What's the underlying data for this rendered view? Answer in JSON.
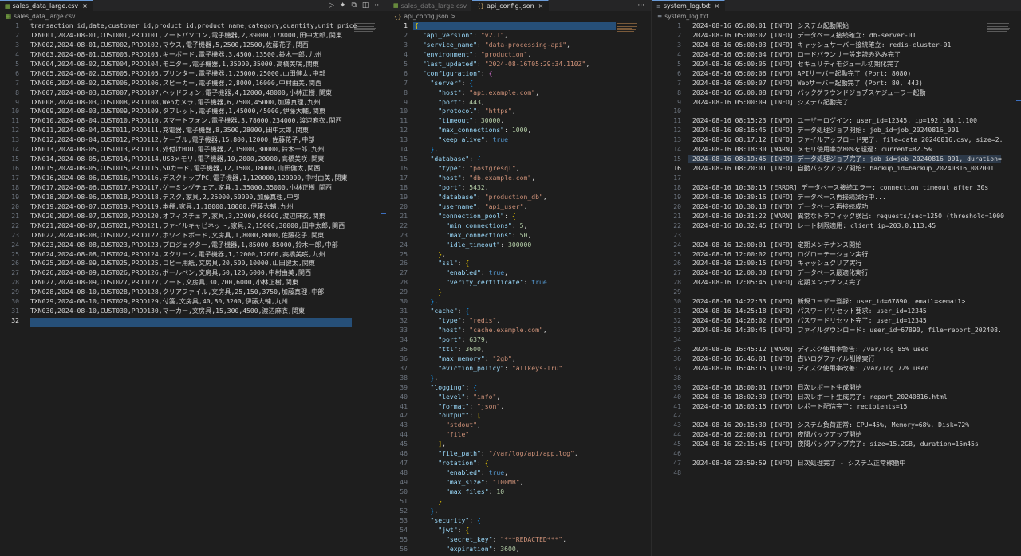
{
  "csv_pane": {
    "tab": {
      "label": "sales_data_large.csv",
      "close": "×"
    },
    "breadcrumb": "sales_data_large.csv",
    "current_line": "32",
    "lines": [
      "transaction_id,date,customer_id,product_id,product_name,category,quantity,unit_price",
      "TXN001,2024-08-01,CUST001,PROD101,ノートパソコン,電子機器,2,89000,178000,田中太郎,関東",
      "TXN002,2024-08-01,CUST002,PROD102,マウス,電子機器,5,2500,12500,佐藤花子,関西",
      "TXN003,2024-08-01,CUST003,PROD103,キーボード,電子機器,3,4500,13500,鈴木一郎,九州",
      "TXN004,2024-08-02,CUST004,PROD104,モニター,電子機器,1,35000,35000,高橋美咲,関東",
      "TXN005,2024-08-02,CUST005,PROD105,プリンター,電子機器,1,25000,25000,山田健太,中部",
      "TXN006,2024-08-02,CUST006,PROD106,スピーカー,電子機器,2,8000,16000,中村由美,関西",
      "TXN007,2024-08-03,CUST007,PROD107,ヘッドフォン,電子機器,4,12000,48000,小林正樹,関東",
      "TXN008,2024-08-03,CUST008,PROD108,Webカメラ,電子機器,6,7500,45000,加藤真理,九州",
      "TXN009,2024-08-03,CUST009,PROD109,タブレット,電子機器,1,45000,45000,伊藤大輔,関東",
      "TXN010,2024-08-04,CUST010,PROD110,スマートフォン,電子機器,3,78000,234000,渡辺麻衣,関西",
      "TXN011,2024-08-04,CUST011,PROD111,充電器,電子機器,8,3500,28000,田中太郎,関東",
      "TXN012,2024-08-04,CUST012,PROD112,ケーブル,電子機器,15,800,12000,佐藤花子,中部",
      "TXN013,2024-08-05,CUST013,PROD113,外付けHDD,電子機器,2,15000,30000,鈴木一郎,九州",
      "TXN014,2024-08-05,CUST014,PROD114,USBメモリ,電子機器,10,2000,20000,高橋美咲,関東",
      "TXN015,2024-08-05,CUST015,PROD115,SDカード,電子機器,12,1500,18000,山田健太,関西",
      "TXN016,2024-08-06,CUST016,PROD116,デスクトップPC,電子機器,1,120000,120000,中村由美,関東",
      "TXN017,2024-08-06,CUST017,PROD117,ゲーミングチェア,家具,1,35000,35000,小林正樹,関西",
      "TXN018,2024-08-06,CUST018,PROD118,デスク,家具,2,25000,50000,加藤真理,中部",
      "TXN019,2024-08-07,CUST019,PROD119,本棚,家具,1,18000,18000,伊藤大輔,九州",
      "TXN020,2024-08-07,CUST020,PROD120,オフィスチェア,家具,3,22000,66000,渡辺麻衣,関東",
      "TXN021,2024-08-07,CUST021,PROD121,ファイルキャビネット,家具,2,15000,30000,田中太郎,関西",
      "TXN022,2024-08-08,CUST022,PROD122,ホワイトボード,文房具,1,8000,8000,佐藤花子,関東",
      "TXN023,2024-08-08,CUST023,PROD123,プロジェクター,電子機器,1,85000,85000,鈴木一郎,中部",
      "TXN024,2024-08-08,CUST024,PROD124,スクリーン,電子機器,1,12000,12000,高橋美咲,九州",
      "TXN025,2024-08-09,CUST025,PROD125,コピー用紙,文房具,20,500,10000,山田健太,関東",
      "TXN026,2024-08-09,CUST026,PROD126,ボールペン,文房具,50,120,6000,中村由美,関西",
      "TXN027,2024-08-09,CUST027,PROD127,ノート,文房具,30,200,6000,小林正樹,関東",
      "TXN028,2024-08-10,CUST028,PROD128,クリアファイル,文房具,25,150,3750,加藤真理,中部",
      "TXN029,2024-08-10,CUST029,PROD129,付箋,文房具,40,80,3200,伊藤大輔,九州",
      "TXN030,2024-08-10,CUST030,PROD130,マーカー,文房具,15,300,4500,渡辺麻衣,関東",
      ""
    ]
  },
  "json_pane": {
    "tab_inactive": {
      "label": "sales_data_large.csv"
    },
    "tab": {
      "label": "api_config.json",
      "close": "×"
    },
    "breadcrumb": {
      "file": "api_config.json",
      "sep": ">",
      "rest": "..."
    },
    "more": "···",
    "current_line": "1",
    "lines": [
      [
        [
          "br1",
          "{"
        ]
      ],
      [
        [
          "p",
          "  "
        ],
        [
          "k",
          "\"api_version\""
        ],
        [
          "p",
          ": "
        ],
        [
          "s",
          "\"v2.1\""
        ],
        [
          "p",
          ","
        ]
      ],
      [
        [
          "p",
          "  "
        ],
        [
          "k",
          "\"service_name\""
        ],
        [
          "p",
          ": "
        ],
        [
          "s",
          "\"data-processing-api\""
        ],
        [
          "p",
          ","
        ]
      ],
      [
        [
          "p",
          "  "
        ],
        [
          "k",
          "\"environment\""
        ],
        [
          "p",
          ": "
        ],
        [
          "s",
          "\"production\""
        ],
        [
          "p",
          ","
        ]
      ],
      [
        [
          "p",
          "  "
        ],
        [
          "k",
          "\"last_updated\""
        ],
        [
          "p",
          ": "
        ],
        [
          "s",
          "\"2024-08-16T05:29:34.110Z\""
        ],
        [
          "p",
          ","
        ]
      ],
      [
        [
          "p",
          "  "
        ],
        [
          "k",
          "\"configuration\""
        ],
        [
          "p",
          ": "
        ],
        [
          "br2",
          "{"
        ]
      ],
      [
        [
          "p",
          "    "
        ],
        [
          "k",
          "\"server\""
        ],
        [
          "p",
          ": "
        ],
        [
          "br3",
          "{"
        ]
      ],
      [
        [
          "p",
          "      "
        ],
        [
          "k",
          "\"host\""
        ],
        [
          "p",
          ": "
        ],
        [
          "s",
          "\"api.example.com\""
        ],
        [
          "p",
          ","
        ]
      ],
      [
        [
          "p",
          "      "
        ],
        [
          "k",
          "\"port\""
        ],
        [
          "p",
          ": "
        ],
        [
          "n",
          "443"
        ],
        [
          "p",
          ","
        ]
      ],
      [
        [
          "p",
          "      "
        ],
        [
          "k",
          "\"protocol\""
        ],
        [
          "p",
          ": "
        ],
        [
          "s",
          "\"https\""
        ],
        [
          "p",
          ","
        ]
      ],
      [
        [
          "p",
          "      "
        ],
        [
          "k",
          "\"timeout\""
        ],
        [
          "p",
          ": "
        ],
        [
          "n",
          "30000"
        ],
        [
          "p",
          ","
        ]
      ],
      [
        [
          "p",
          "      "
        ],
        [
          "k",
          "\"max_connections\""
        ],
        [
          "p",
          ": "
        ],
        [
          "n",
          "1000"
        ],
        [
          "p",
          ","
        ]
      ],
      [
        [
          "p",
          "      "
        ],
        [
          "k",
          "\"keep_alive\""
        ],
        [
          "p",
          ": "
        ],
        [
          "b",
          "true"
        ]
      ],
      [
        [
          "p",
          "    "
        ],
        [
          "br3",
          "}"
        ],
        [
          "p",
          ","
        ]
      ],
      [
        [
          "p",
          "    "
        ],
        [
          "k",
          "\"database\""
        ],
        [
          "p",
          ": "
        ],
        [
          "br3",
          "{"
        ]
      ],
      [
        [
          "p",
          "      "
        ],
        [
          "k",
          "\"type\""
        ],
        [
          "p",
          ": "
        ],
        [
          "s",
          "\"postgresql\""
        ],
        [
          "p",
          ","
        ]
      ],
      [
        [
          "p",
          "      "
        ],
        [
          "k",
          "\"host\""
        ],
        [
          "p",
          ": "
        ],
        [
          "s",
          "\"db.example.com\""
        ],
        [
          "p",
          ","
        ]
      ],
      [
        [
          "p",
          "      "
        ],
        [
          "k",
          "\"port\""
        ],
        [
          "p",
          ": "
        ],
        [
          "n",
          "5432"
        ],
        [
          "p",
          ","
        ]
      ],
      [
        [
          "p",
          "      "
        ],
        [
          "k",
          "\"database\""
        ],
        [
          "p",
          ": "
        ],
        [
          "s",
          "\"production_db\""
        ],
        [
          "p",
          ","
        ]
      ],
      [
        [
          "p",
          "      "
        ],
        [
          "k",
          "\"username\""
        ],
        [
          "p",
          ": "
        ],
        [
          "s",
          "\"api_user\""
        ],
        [
          "p",
          ","
        ]
      ],
      [
        [
          "p",
          "      "
        ],
        [
          "k",
          "\"connection_pool\""
        ],
        [
          "p",
          ": "
        ],
        [
          "br1",
          "{"
        ]
      ],
      [
        [
          "p",
          "        "
        ],
        [
          "k",
          "\"min_connections\""
        ],
        [
          "p",
          ": "
        ],
        [
          "n",
          "5"
        ],
        [
          "p",
          ","
        ]
      ],
      [
        [
          "p",
          "        "
        ],
        [
          "k",
          "\"max_connections\""
        ],
        [
          "p",
          ": "
        ],
        [
          "n",
          "50"
        ],
        [
          "p",
          ","
        ]
      ],
      [
        [
          "p",
          "        "
        ],
        [
          "k",
          "\"idle_timeout\""
        ],
        [
          "p",
          ": "
        ],
        [
          "n",
          "300000"
        ]
      ],
      [
        [
          "p",
          "      "
        ],
        [
          "br1",
          "}"
        ],
        [
          "p",
          ","
        ]
      ],
      [
        [
          "p",
          "      "
        ],
        [
          "k",
          "\"ssl\""
        ],
        [
          "p",
          ": "
        ],
        [
          "br1",
          "{"
        ]
      ],
      [
        [
          "p",
          "        "
        ],
        [
          "k",
          "\"enabled\""
        ],
        [
          "p",
          ": "
        ],
        [
          "b",
          "true"
        ],
        [
          "p",
          ","
        ]
      ],
      [
        [
          "p",
          "        "
        ],
        [
          "k",
          "\"verify_certificate\""
        ],
        [
          "p",
          ": "
        ],
        [
          "b",
          "true"
        ]
      ],
      [
        [
          "p",
          "      "
        ],
        [
          "br1",
          "}"
        ]
      ],
      [
        [
          "p",
          "    "
        ],
        [
          "br3",
          "}"
        ],
        [
          "p",
          ","
        ]
      ],
      [
        [
          "p",
          "    "
        ],
        [
          "k",
          "\"cache\""
        ],
        [
          "p",
          ": "
        ],
        [
          "br3",
          "{"
        ]
      ],
      [
        [
          "p",
          "      "
        ],
        [
          "k",
          "\"type\""
        ],
        [
          "p",
          ": "
        ],
        [
          "s",
          "\"redis\""
        ],
        [
          "p",
          ","
        ]
      ],
      [
        [
          "p",
          "      "
        ],
        [
          "k",
          "\"host\""
        ],
        [
          "p",
          ": "
        ],
        [
          "s",
          "\"cache.example.com\""
        ],
        [
          "p",
          ","
        ]
      ],
      [
        [
          "p",
          "      "
        ],
        [
          "k",
          "\"port\""
        ],
        [
          "p",
          ": "
        ],
        [
          "n",
          "6379"
        ],
        [
          "p",
          ","
        ]
      ],
      [
        [
          "p",
          "      "
        ],
        [
          "k",
          "\"ttl\""
        ],
        [
          "p",
          ": "
        ],
        [
          "n",
          "3600"
        ],
        [
          "p",
          ","
        ]
      ],
      [
        [
          "p",
          "      "
        ],
        [
          "k",
          "\"max_memory\""
        ],
        [
          "p",
          ": "
        ],
        [
          "s",
          "\"2gb\""
        ],
        [
          "p",
          ","
        ]
      ],
      [
        [
          "p",
          "      "
        ],
        [
          "k",
          "\"eviction_policy\""
        ],
        [
          "p",
          ": "
        ],
        [
          "s",
          "\"allkeys-lru\""
        ]
      ],
      [
        [
          "p",
          "    "
        ],
        [
          "br3",
          "}"
        ],
        [
          "p",
          ","
        ]
      ],
      [
        [
          "p",
          "    "
        ],
        [
          "k",
          "\"logging\""
        ],
        [
          "p",
          ": "
        ],
        [
          "br3",
          "{"
        ]
      ],
      [
        [
          "p",
          "      "
        ],
        [
          "k",
          "\"level\""
        ],
        [
          "p",
          ": "
        ],
        [
          "s",
          "\"info\""
        ],
        [
          "p",
          ","
        ]
      ],
      [
        [
          "p",
          "      "
        ],
        [
          "k",
          "\"format\""
        ],
        [
          "p",
          ": "
        ],
        [
          "s",
          "\"json\""
        ],
        [
          "p",
          ","
        ]
      ],
      [
        [
          "p",
          "      "
        ],
        [
          "k",
          "\"output\""
        ],
        [
          "p",
          ": "
        ],
        [
          "br1",
          "["
        ]
      ],
      [
        [
          "p",
          "        "
        ],
        [
          "s",
          "\"stdout\""
        ],
        [
          "p",
          ","
        ]
      ],
      [
        [
          "p",
          "        "
        ],
        [
          "s",
          "\"file\""
        ]
      ],
      [
        [
          "p",
          "      "
        ],
        [
          "br1",
          "]"
        ],
        [
          "p",
          ","
        ]
      ],
      [
        [
          "p",
          "      "
        ],
        [
          "k",
          "\"file_path\""
        ],
        [
          "p",
          ": "
        ],
        [
          "s",
          "\"/var/log/api/app.log\""
        ],
        [
          "p",
          ","
        ]
      ],
      [
        [
          "p",
          "      "
        ],
        [
          "k",
          "\"rotation\""
        ],
        [
          "p",
          ": "
        ],
        [
          "br1",
          "{"
        ]
      ],
      [
        [
          "p",
          "        "
        ],
        [
          "k",
          "\"enabled\""
        ],
        [
          "p",
          ": "
        ],
        [
          "b",
          "true"
        ],
        [
          "p",
          ","
        ]
      ],
      [
        [
          "p",
          "        "
        ],
        [
          "k",
          "\"max_size\""
        ],
        [
          "p",
          ": "
        ],
        [
          "s",
          "\"100MB\""
        ],
        [
          "p",
          ","
        ]
      ],
      [
        [
          "p",
          "        "
        ],
        [
          "k",
          "\"max_files\""
        ],
        [
          "p",
          ": "
        ],
        [
          "n",
          "10"
        ]
      ],
      [
        [
          "p",
          "      "
        ],
        [
          "br1",
          "}"
        ]
      ],
      [
        [
          "p",
          "    "
        ],
        [
          "br3",
          "}"
        ],
        [
          "p",
          ","
        ]
      ],
      [
        [
          "p",
          "    "
        ],
        [
          "k",
          "\"security\""
        ],
        [
          "p",
          ": "
        ],
        [
          "br3",
          "{"
        ]
      ],
      [
        [
          "p",
          "      "
        ],
        [
          "k",
          "\"jwt\""
        ],
        [
          "p",
          ": "
        ],
        [
          "br1",
          "{"
        ]
      ],
      [
        [
          "p",
          "        "
        ],
        [
          "k",
          "\"secret_key\""
        ],
        [
          "p",
          ": "
        ],
        [
          "s",
          "\"***REDACTED***\""
        ],
        [
          "p",
          ","
        ]
      ],
      [
        [
          "p",
          "        "
        ],
        [
          "k",
          "\"expiration\""
        ],
        [
          "p",
          ": "
        ],
        [
          "n",
          "3600"
        ],
        [
          "p",
          ","
        ]
      ]
    ]
  },
  "log_pane": {
    "tab": {
      "label": "system_log.txt",
      "close": "×"
    },
    "breadcrumb": "system_log.txt",
    "current_line": "16",
    "lines": [
      "2024-08-16 05:00:01 [INFO] システム起動開始",
      "2024-08-16 05:00:02 [INFO] データベース接続確立: db-server-01",
      "2024-08-16 05:00:03 [INFO] キャッシュサーバー接続確立: redis-cluster-01",
      "2024-08-16 05:00:04 [INFO] ロードバランサー設定読み込み完了",
      "2024-08-16 05:00:05 [INFO] セキュリティモジュール初期化完了",
      "2024-08-16 05:00:06 [INFO] APIサーバー起動完了 (Port: 8080)",
      "2024-08-16 05:00:07 [INFO] Webサーバー起動完了 (Port: 80, 443)",
      "2024-08-16 05:00:08 [INFO] バックグラウンドジョブスケジューラー起動",
      "2024-08-16 05:00:09 [INFO] システム起動完了",
      "",
      "2024-08-16 08:15:23 [INFO] ユーザーログイン: user_id=12345, ip=192.168.1.100",
      "2024-08-16 08:16:45 [INFO] データ処理ジョブ開始: job_id=job_20240816_001",
      "2024-08-16 08:17:12 [INFO] ファイルアップロード完了: file=data_20240816.csv, size=2.",
      "2024-08-16 08:18:30 [WARN] メモリ使用率が80%を超過: current=82.5%",
      "2024-08-16 08:19:45 [INFO] データ処理ジョブ完了: job_id=job_20240816_001, duration=",
      "2024-08-16 08:20:01 [INFO] 自動バックアップ開始: backup_id=backup_20240816_082001",
      "",
      "2024-08-16 10:30:15 [ERROR] データベース接続エラー: connection timeout after 30s",
      "2024-08-16 10:30:16 [INFO] データベース再接続試行中...",
      "2024-08-16 10:30:18 [INFO] データベース再接続成功",
      "2024-08-16 10:31:22 [WARN] 異常なトラフィック検出: requests/sec=1250 (threshold=1000",
      "2024-08-16 10:32:45 [INFO] レート制限適用: client_ip=203.0.113.45",
      "",
      "2024-08-16 12:00:01 [INFO] 定期メンテナンス開始",
      "2024-08-16 12:00:02 [INFO] ログローテーション実行",
      "2024-08-16 12:00:15 [INFO] キャッシュクリア実行",
      "2024-08-16 12:00:30 [INFO] データベース最適化実行",
      "2024-08-16 12:05:45 [INFO] 定期メンテナンス完了",
      "",
      "2024-08-16 14:22:33 [INFO] 新規ユーザー登録: user_id=67890, email=<email>",
      "2024-08-16 14:25:18 [INFO] パスワードリセット要求: user_id=12345",
      "2024-08-16 14:26:02 [INFO] パスワードリセット完了: user_id=12345",
      "2024-08-16 14:30:45 [INFO] ファイルダウンロード: user_id=67890, file=report_202408.",
      "",
      "2024-08-16 16:45:12 [WARN] ディスク使用率警告: /var/log 85% used",
      "2024-08-16 16:46:01 [INFO] 古いログファイル削除実行",
      "2024-08-16 16:46:15 [INFO] ディスク使用率改善: /var/log 72% used",
      "",
      "2024-08-16 18:00:01 [INFO] 日次レポート生成開始",
      "2024-08-16 18:02:30 [INFO] 日次レポート生成完了: report_20240816.html",
      "2024-08-16 18:03:15 [INFO] レポート配信完了: recipients=15",
      "",
      "2024-08-16 20:15:30 [INFO] システム負荷正常: CPU=45%, Memory=68%, Disk=72%",
      "2024-08-16 22:00:01 [INFO] 夜間バックアップ開始",
      "2024-08-16 22:15:45 [INFO] 夜間バックアップ完了: size=15.2GB, duration=15m45s",
      "",
      "2024-08-16 23:59:59 [INFO] 日次処理完了 - システム正常稼働中",
      ""
    ]
  },
  "icons": {
    "run": "▷",
    "sparkle": "✦",
    "copy": "⧉",
    "split": "◫",
    "more": "···",
    "file_csv": "▦",
    "file_json": "{}",
    "file_txt": "≡"
  }
}
